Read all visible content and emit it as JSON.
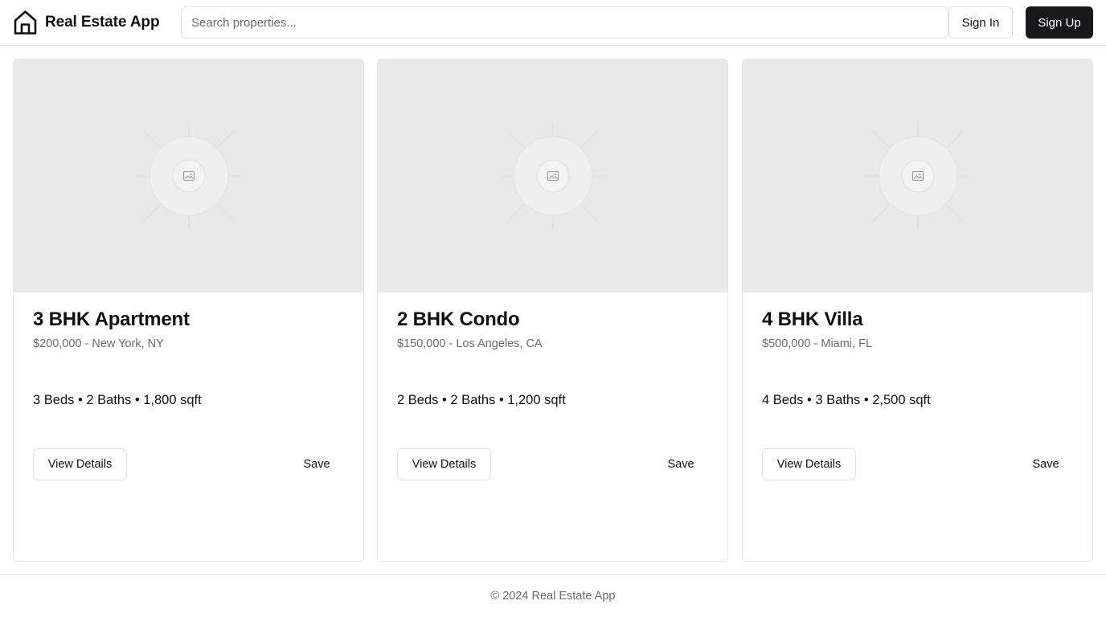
{
  "header": {
    "title": "Real Estate App",
    "brand_icon": "home-icon",
    "search": {
      "placeholder": "Search properties...",
      "value": ""
    },
    "signin_label": "Sign In",
    "signup_label": "Sign Up"
  },
  "listings": [
    {
      "title": "3 BHK Apartment",
      "subtitle": "$200,000 - New York, NY",
      "features": "3 Beds • 2 Baths • 1,800 sqft",
      "image_icon": "image-placeholder-icon",
      "view_label": "View Details",
      "save_label": "Save"
    },
    {
      "title": "2 BHK Condo",
      "subtitle": "$150,000 - Los Angeles, CA",
      "features": "2 Beds • 2 Baths • 1,200 sqft",
      "image_icon": "image-placeholder-icon",
      "view_label": "View Details",
      "save_label": "Save"
    },
    {
      "title": "4 BHK Villa",
      "subtitle": "$500,000 - Miami, FL",
      "features": "4 Beds • 3 Baths • 2,500 sqft",
      "image_icon": "image-placeholder-icon",
      "view_label": "View Details",
      "save_label": "Save"
    }
  ],
  "footer": {
    "text": "© 2024 Real Estate App"
  },
  "colors": {
    "accent_dark": "#18181b",
    "border": "#e5e5e5",
    "muted_text": "#6b6b6b",
    "image_placeholder_bg": "#e9e9e9"
  }
}
